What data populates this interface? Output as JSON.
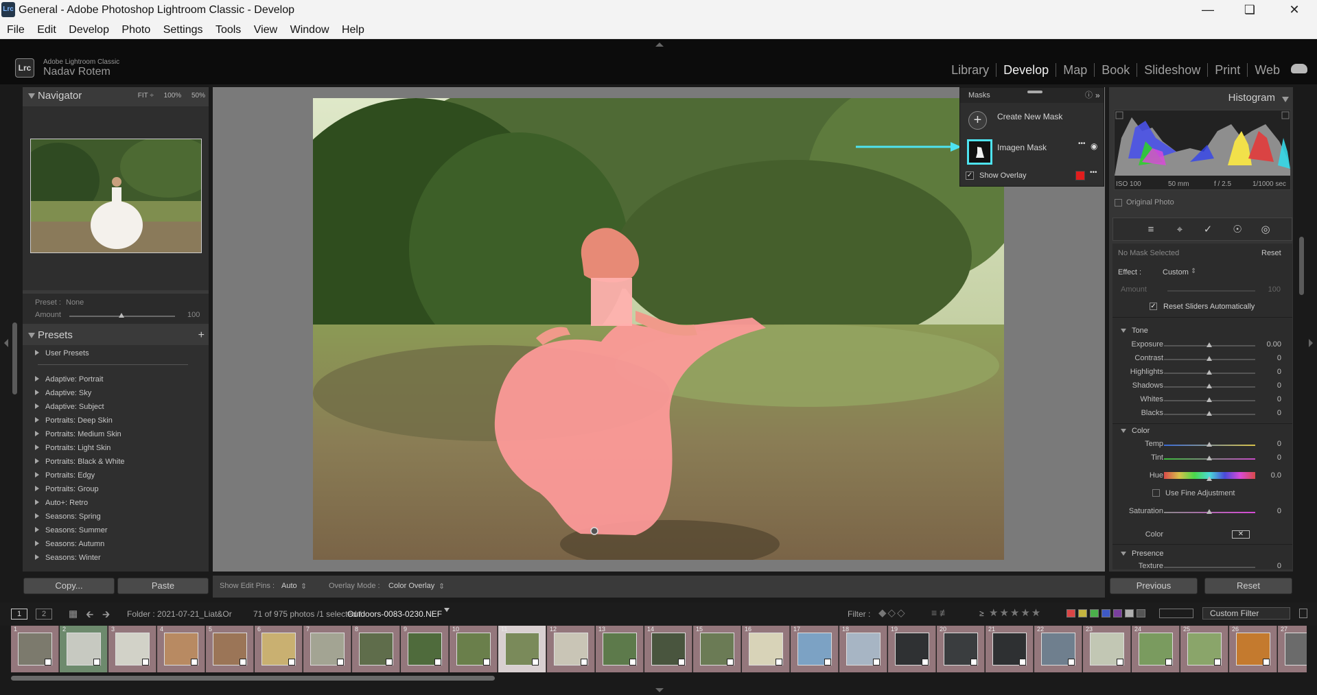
{
  "window": {
    "title": "General - Adobe Photoshop Lightroom Classic - Develop",
    "logo": "Lrc"
  },
  "menu": [
    "File",
    "Edit",
    "Develop",
    "Photo",
    "Settings",
    "Tools",
    "View",
    "Window",
    "Help"
  ],
  "identity": {
    "badge": "Lrc",
    "product": "Adobe Lightroom Classic",
    "user": "Nadav Rotem"
  },
  "modules": [
    "Library",
    "Develop",
    "Map",
    "Book",
    "Slideshow",
    "Print",
    "Web"
  ],
  "navigator": {
    "title": "Navigator",
    "zoom": [
      "FIT ÷",
      "100%",
      "50%"
    ]
  },
  "preset_box": {
    "preset_label": "Preset :",
    "preset_value": "None",
    "amount_label": "Amount",
    "amount_value": "100"
  },
  "presets": {
    "title": "Presets",
    "add": "+",
    "items": [
      "User Presets",
      "Adaptive: Portrait",
      "Adaptive: Sky",
      "Adaptive: Subject",
      "Portraits: Deep Skin",
      "Portraits: Medium Skin",
      "Portraits: Light Skin",
      "Portraits: Black & White",
      "Portraits: Edgy",
      "Portraits: Group",
      "Auto+: Retro",
      "Seasons: Spring",
      "Seasons: Summer",
      "Seasons: Autumn",
      "Seasons: Winter"
    ]
  },
  "left_buttons": {
    "copy": "Copy...",
    "paste": "Paste"
  },
  "masks": {
    "title": "Masks",
    "create": "Create New Mask",
    "mask_name": "Imagen Mask",
    "show_overlay": "Show Overlay",
    "more": "•••",
    "overlay_color": "#e11d1d"
  },
  "toolbar": {
    "show_pins_label": "Show Edit Pins :",
    "show_pins_value": "Auto",
    "overlay_label": "Overlay Mode :",
    "overlay_value": "Color Overlay"
  },
  "histogram": {
    "title": "Histogram",
    "iso": "ISO 100",
    "focal": "50 mm",
    "aperture": "f / 2.5",
    "shutter": "1/1000 sec",
    "original_photo": "Original Photo"
  },
  "mask_editor": {
    "no_mask": "No Mask Selected",
    "reset": "Reset",
    "effect_label": "Effect :",
    "effect_value": "Custom",
    "amount_label": "Amount",
    "amount_value": "100",
    "reset_sliders": "Reset Sliders Automatically",
    "tone_title": "Tone",
    "tone": [
      {
        "label": "Exposure",
        "value": "0.00"
      },
      {
        "label": "Contrast",
        "value": "0"
      },
      {
        "label": "Highlights",
        "value": "0"
      },
      {
        "label": "Shadows",
        "value": "0"
      },
      {
        "label": "Whites",
        "value": "0"
      },
      {
        "label": "Blacks",
        "value": "0"
      }
    ],
    "color_title": "Color",
    "color": [
      {
        "label": "Temp",
        "value": "0"
      },
      {
        "label": "Tint",
        "value": "0"
      },
      {
        "label": "Hue",
        "value": "0.0"
      }
    ],
    "fine_adjust": "Use Fine Adjustment",
    "saturation_label": "Saturation",
    "saturation_value": "0",
    "color_label": "Color",
    "presence_title": "Presence",
    "texture_label": "Texture",
    "texture_value": "0"
  },
  "right_buttons": {
    "previous": "Previous",
    "reset": "Reset"
  },
  "filmbar": {
    "view1": "1",
    "view2": "2",
    "folder": "Folder : 2021-07-21_Liat&Or",
    "count": "71 of 975 photos /1 selected /",
    "filename": "Outdoors-0083-0230.NEF",
    "filter_label": "Filter :",
    "rating_op": "≥",
    "stars": "★★★★★",
    "custom_filter": "Custom Filter"
  },
  "filmstrip": {
    "numbers": [
      "1",
      "2",
      "3",
      "4",
      "5",
      "6",
      "7",
      "8",
      "9",
      "10",
      "11",
      "12",
      "13",
      "14",
      "15",
      "16",
      "17",
      "18",
      "19",
      "20",
      "21",
      "22",
      "23",
      "24",
      "25",
      "26",
      "27"
    ]
  },
  "colors": {
    "accent_cyan": "#4ee3f0",
    "mask_overlay": "#ff8f8f"
  }
}
